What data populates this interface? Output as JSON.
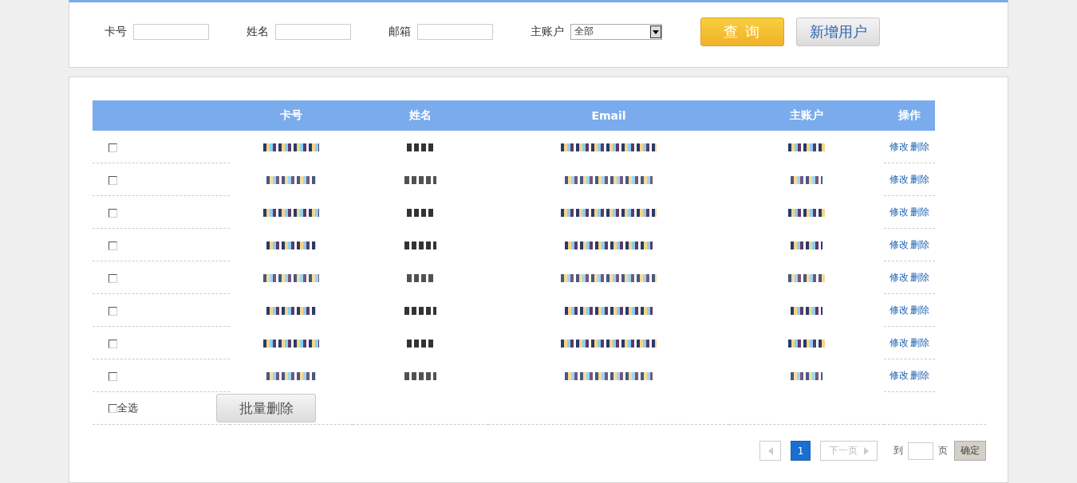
{
  "search": {
    "fields": [
      {
        "label": "卡号"
      },
      {
        "label": "姓名"
      },
      {
        "label": "邮箱"
      }
    ],
    "account": {
      "label": "主账户",
      "value": "全部"
    },
    "buttons": [
      {
        "kind": "primary",
        "label": "查 询"
      },
      {
        "kind": "secondary",
        "label": "新增用户"
      }
    ]
  },
  "table": {
    "columns": [
      "",
      "卡号",
      "姓名",
      "Email",
      "主账户",
      "操作"
    ],
    "rows": [
      {
        "checked": false,
        "actions": [
          "修改",
          "删除"
        ]
      },
      {
        "checked": false,
        "actions": [
          "修改",
          "删除"
        ]
      },
      {
        "checked": false,
        "actions": [
          "修改",
          "删除"
        ]
      },
      {
        "checked": false,
        "actions": [
          "修改",
          "删除"
        ]
      },
      {
        "checked": false,
        "actions": [
          "修改",
          "删除"
        ]
      },
      {
        "checked": false,
        "actions": [
          "修改",
          "删除"
        ]
      },
      {
        "checked": false,
        "actions": [
          "修改",
          "删除"
        ]
      },
      {
        "checked": false,
        "actions": [
          "修改",
          "删除"
        ]
      }
    ],
    "select_all": {
      "label": "全选",
      "checked": false
    },
    "batch_button": "批量删除"
  },
  "pagination": {
    "pages": [
      {
        "label": "1",
        "selected": true
      }
    ],
    "next": "下一页",
    "goto_label": "到",
    "page_unit": "页",
    "confirm": "确定"
  }
}
